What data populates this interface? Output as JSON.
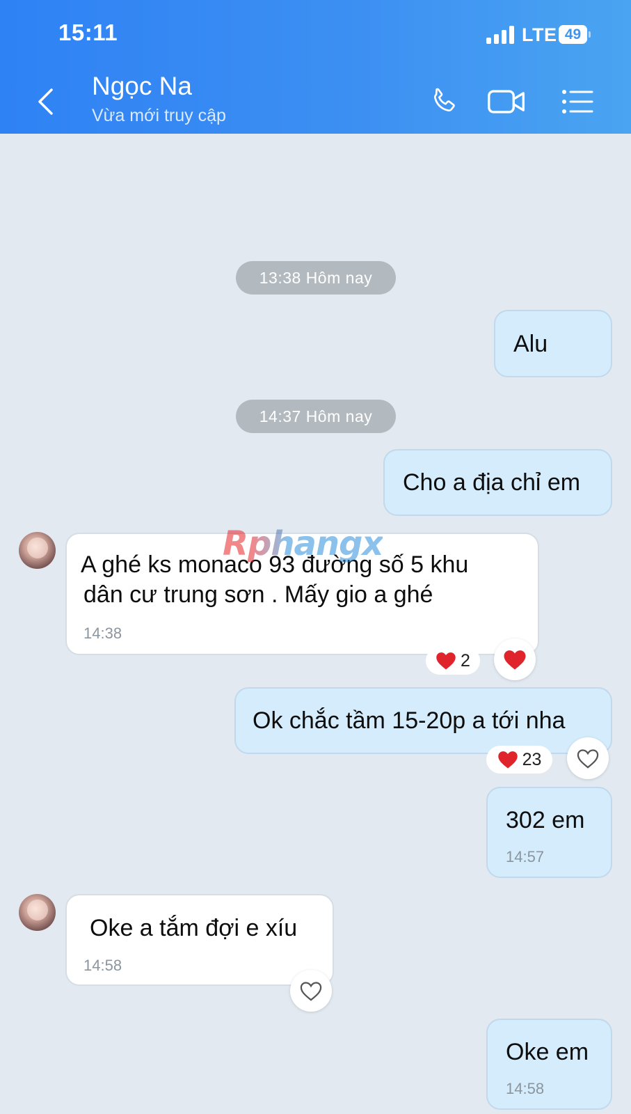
{
  "status_bar": {
    "time": "15:11",
    "network": "LTE",
    "battery": "49",
    "battery_level": 0.49
  },
  "header": {
    "contact_name": "Ngọc Na",
    "contact_status": "Vừa mới truy cập",
    "icons": [
      "back-icon",
      "phone-icon",
      "video-call-icon",
      "menu-icon"
    ]
  },
  "chat": {
    "time_separators": [
      "13:38 Hôm nay",
      "14:37 Hôm nay"
    ],
    "messages": [
      {
        "direction": "out",
        "text": "Alu"
      },
      {
        "direction": "out",
        "text": "Cho a địa chỉ em"
      },
      {
        "direction": "in",
        "lines": [
          " A ghé ks monaco 93 đường số 5 khu",
          "dân cư trung sơn . Mấy gio a ghé"
        ],
        "time": "14:38",
        "reaction_count": "2"
      },
      {
        "direction": "out",
        "text": "Ok chắc tầm 15-20p a tới nha",
        "reaction_count": "23"
      },
      {
        "direction": "out",
        "text": "302 em",
        "time": "14:57"
      },
      {
        "direction": "in",
        "text": "Oke a tắm đợi e xíu",
        "time": "14:58"
      },
      {
        "direction": "out",
        "text": "Oke em",
        "time": "14:58"
      }
    ]
  },
  "watermark": "Rphangx",
  "colors": {
    "header_start": "#2f82f4",
    "header_end": "#4aa4f1",
    "chat_background": "#e2e9f1",
    "outgoing_bubble": "#d4ecfb",
    "incoming_bubble": "#ffffff",
    "heart": "#e0242c"
  }
}
